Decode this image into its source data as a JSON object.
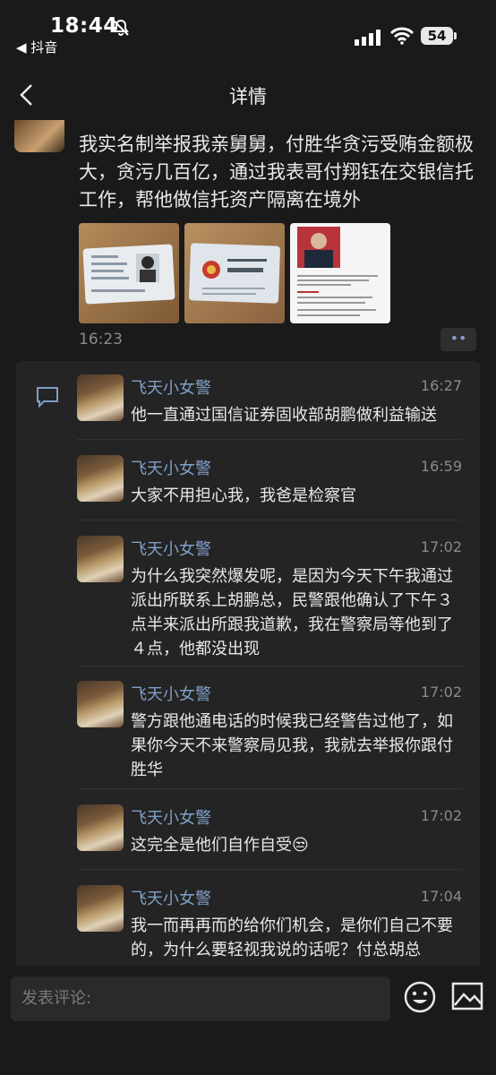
{
  "status": {
    "time": "18:44",
    "back_app": "◀ 抖音",
    "battery": "54"
  },
  "nav": {
    "title": "详情"
  },
  "post": {
    "text": "我实名制举报我亲舅舅，付胜华贪污受贿金额极大，贪污几百亿，通过我表哥付翔钰在交银信托工作，帮他做信托资产隔离在境外",
    "time": "16:23",
    "more": "••"
  },
  "comments": [
    {
      "name": "飞天小女警",
      "time": "16:27",
      "text": "他一直通过国信证券固收部胡鹏做利益输送"
    },
    {
      "name": "飞天小女警",
      "time": "16:59",
      "text": "大家不用担心我，我爸是检察官"
    },
    {
      "name": "飞天小女警",
      "time": "17:02",
      "text": "为什么我突然爆发呢，是因为今天下午我通过派出所联系上胡鹏总，民警跟他确认了下午３点半来派出所跟我道歉，我在警察局等他到了４点，他都没出现"
    },
    {
      "name": "飞天小女警",
      "time": "17:02",
      "text": "警方跟他通电话的时候我已经警告过他了，如果你今天不来警察局见我，我就去举报你跟付胜华"
    },
    {
      "name": "飞天小女警",
      "time": "17:02",
      "text": "这完全是他们自作自受😒"
    },
    {
      "name": "飞天小女警",
      "time": "17:04",
      "text": "我一而再再而的给你们机会，是你们自己不要的，为什么要轻视我说的话呢？付总胡总"
    }
  ],
  "composer": {
    "placeholder": "发表评论:"
  },
  "colors": {
    "background": "#1a1a1a",
    "panel": "#242424",
    "name_link": "#7f9fc7"
  }
}
